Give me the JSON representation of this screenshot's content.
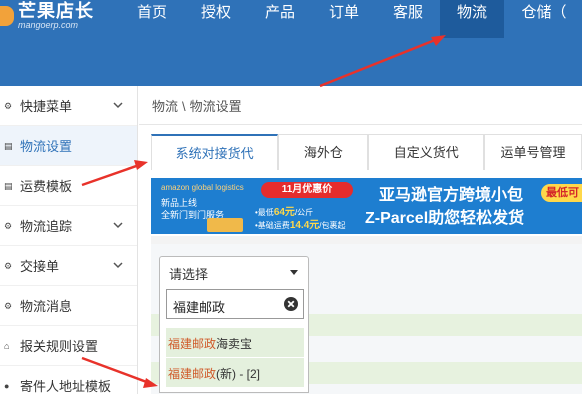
{
  "logo": {
    "main": "芒果店长",
    "sub": "mangoerp.com"
  },
  "nav": [
    {
      "label": "首页"
    },
    {
      "label": "授权"
    },
    {
      "label": "产品"
    },
    {
      "label": "订单"
    },
    {
      "label": "客服"
    },
    {
      "label": "物流"
    },
    {
      "label": "仓储（"
    }
  ],
  "sidebar": {
    "items": [
      {
        "label": "快捷菜单",
        "icon": "gear-icon",
        "expandable": true
      },
      {
        "label": "物流设置",
        "icon": "list-icon",
        "active": true
      },
      {
        "label": "运费模板",
        "icon": "list-icon"
      },
      {
        "label": "物流追踪",
        "icon": "gear-icon",
        "expandable": true
      },
      {
        "label": "交接单",
        "icon": "gear-icon",
        "expandable": true
      },
      {
        "label": "物流消息",
        "icon": "gear-icon"
      },
      {
        "label": "报关规则设置",
        "icon": "bank-icon"
      },
      {
        "label": "寄件人地址模板",
        "icon": "user-icon"
      }
    ]
  },
  "breadcrumb": {
    "parent": "物流",
    "sep": "\\",
    "current": "物流设置"
  },
  "tabs": [
    {
      "label": "系统对接货代",
      "active": true
    },
    {
      "label": "海外仓"
    },
    {
      "label": "自定义货代"
    },
    {
      "label": "运单号管理"
    }
  ],
  "banner": {
    "brand": "amazon global logistics",
    "line1": "新品上线",
    "line2": "全新门到门服务",
    "promo": "11月优惠价",
    "row1_prefix": "•最低",
    "row1_num": "64元",
    "row1_suffix": "/公斤",
    "row2_prefix": "•基础运费",
    "row2_num": "14.4元",
    "row2_suffix": "/包裹起",
    "title1": "亚马逊官方跨境小包",
    "title2": "Z-Parcel助您轻松发货",
    "badge": "最低可"
  },
  "select": {
    "value": "请选择",
    "search_value": "福建邮政",
    "options": [
      {
        "highlight": "福建邮政",
        "rest": "海卖宝"
      },
      {
        "highlight": "福建邮政",
        "rest": "(新) - [2]"
      }
    ]
  },
  "colors": {
    "nav_bg": "#2f72b8",
    "accent": "#2f72b8",
    "arrow": "#e8322a",
    "option_bg": "#e4f0dd"
  }
}
